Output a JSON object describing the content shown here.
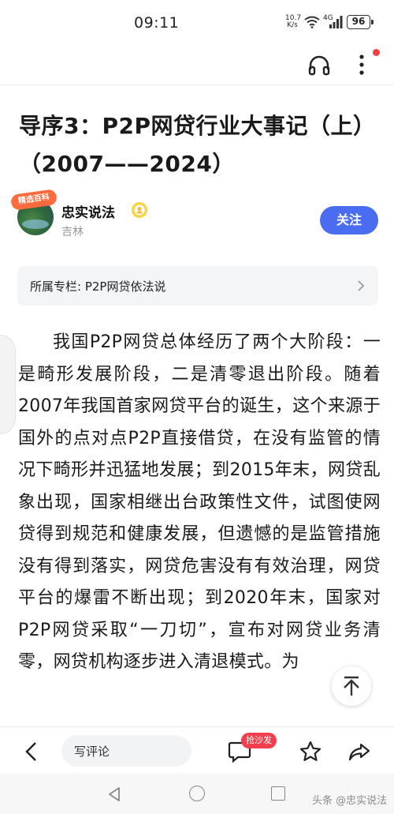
{
  "status_bar": {
    "time": "09:11",
    "net_speed_value": "10.7",
    "net_speed_unit": "K/s",
    "network_type": "4G",
    "battery": "96"
  },
  "article": {
    "title": "导序3：P2P网贷行业大事记（上）（2007——2024）",
    "author": {
      "name": "忠实说法",
      "location": "吉林",
      "avatar_badge": "精选百科"
    },
    "follow_label": "关注",
    "column_label": "所属专栏: P2P网贷依法说",
    "body": "我国P2P网贷总体经历了两个大阶段：一是畸形发展阶段，二是清零退出阶段。随着2007年我国首家网贷平台的诞生，这个来源于国外的点对点P2P直接借贷，在没有监管的情况下畸形并迅猛地发展；到2015年末，网贷乱象出现，国家相继出台政策性文件，试图使网贷得到规范和健康发展，但遗憾的是监管措施没有得到落实，网贷危害没有有效治理，网贷平台的爆雷不断出现；到2020年末，国家对P2P网贷采取“一刀切”，宣布对网贷业务清零，网贷机构逐步进入清退模式。为"
  },
  "toolbar": {
    "comment_placeholder": "写评论",
    "sofa_badge": "抢沙发"
  },
  "watermark": "头条 @忠实说法",
  "colors": {
    "accent": "#4a6cf0",
    "badge_red": "#f33e4e"
  },
  "icons": [
    "headphone-icon",
    "more-vertical-icon",
    "verified-badge-icon",
    "chevron-right-icon",
    "arrow-up-icon",
    "back-arrow-icon",
    "comment-icon",
    "star-icon",
    "share-icon"
  ]
}
